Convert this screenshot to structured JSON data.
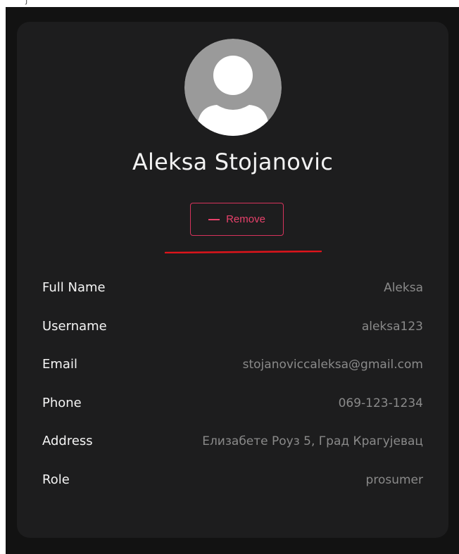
{
  "profile": {
    "name": "Aleksa Stojanovic",
    "remove_label": "Remove"
  },
  "details": [
    {
      "label": "Full Name",
      "value": "Aleksa"
    },
    {
      "label": "Username",
      "value": "aleksa123"
    },
    {
      "label": "Email",
      "value": "stojanoviccaleksa@gmail.com"
    },
    {
      "label": "Phone",
      "value": "069-123-1234"
    },
    {
      "label": "Address",
      "value": "Елизабете Роуз 5, Град Крагујевац"
    },
    {
      "label": "Role",
      "value": "prosumer"
    }
  ],
  "icons": {
    "avatar": "user-avatar-icon",
    "remove": "minus-icon"
  },
  "colors": {
    "page_background": "#121212",
    "card_background": "#1d1d1e",
    "accent": "#e8416b",
    "underline": "#e0141b",
    "label_text": "#f4f4f4",
    "value_text": "#8a8a8a",
    "avatar_background": "#9a9a9a"
  }
}
